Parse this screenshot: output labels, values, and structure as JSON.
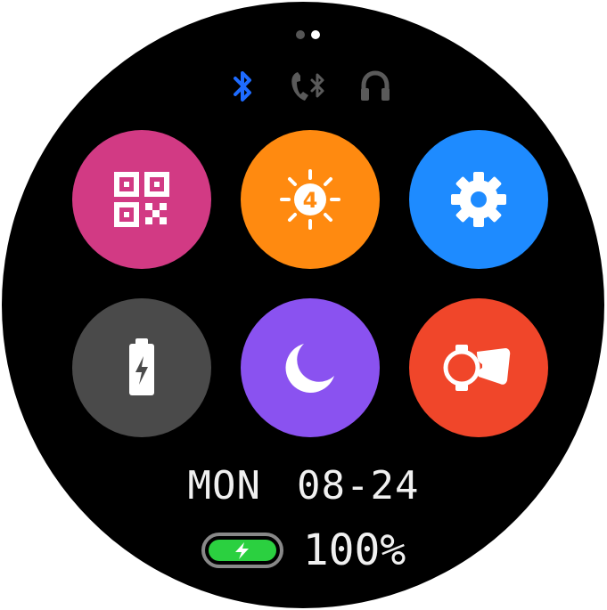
{
  "page_indicator": {
    "pages": 2,
    "current": 2
  },
  "status_icons": [
    {
      "name": "bluetooth-icon",
      "color": "#1e6bff"
    },
    {
      "name": "bluetooth-call-icon",
      "color": "#5a5a5a"
    },
    {
      "name": "headphones-icon",
      "color": "#5a5a5a"
    }
  ],
  "tiles": [
    {
      "name": "qr-code-button",
      "icon": "qr-code-icon",
      "color": "#d23a84"
    },
    {
      "name": "brightness-button",
      "icon": "brightness-icon",
      "color": "#ff8a10",
      "level": "4"
    },
    {
      "name": "settings-button",
      "icon": "gear-icon",
      "color": "#1e8bff"
    },
    {
      "name": "power-saving-button",
      "icon": "battery-charging-icon",
      "color": "#4a4a4a"
    },
    {
      "name": "do-not-disturb-button",
      "icon": "moon-icon",
      "color": "#8a52f0"
    },
    {
      "name": "find-phone-button",
      "icon": "find-phone-icon",
      "color": "#f0462a"
    }
  ],
  "date": {
    "weekday": "MON",
    "date": "08-24"
  },
  "battery": {
    "percent_text": "100%",
    "level": 1.0,
    "fill_color": "#2bd040"
  }
}
